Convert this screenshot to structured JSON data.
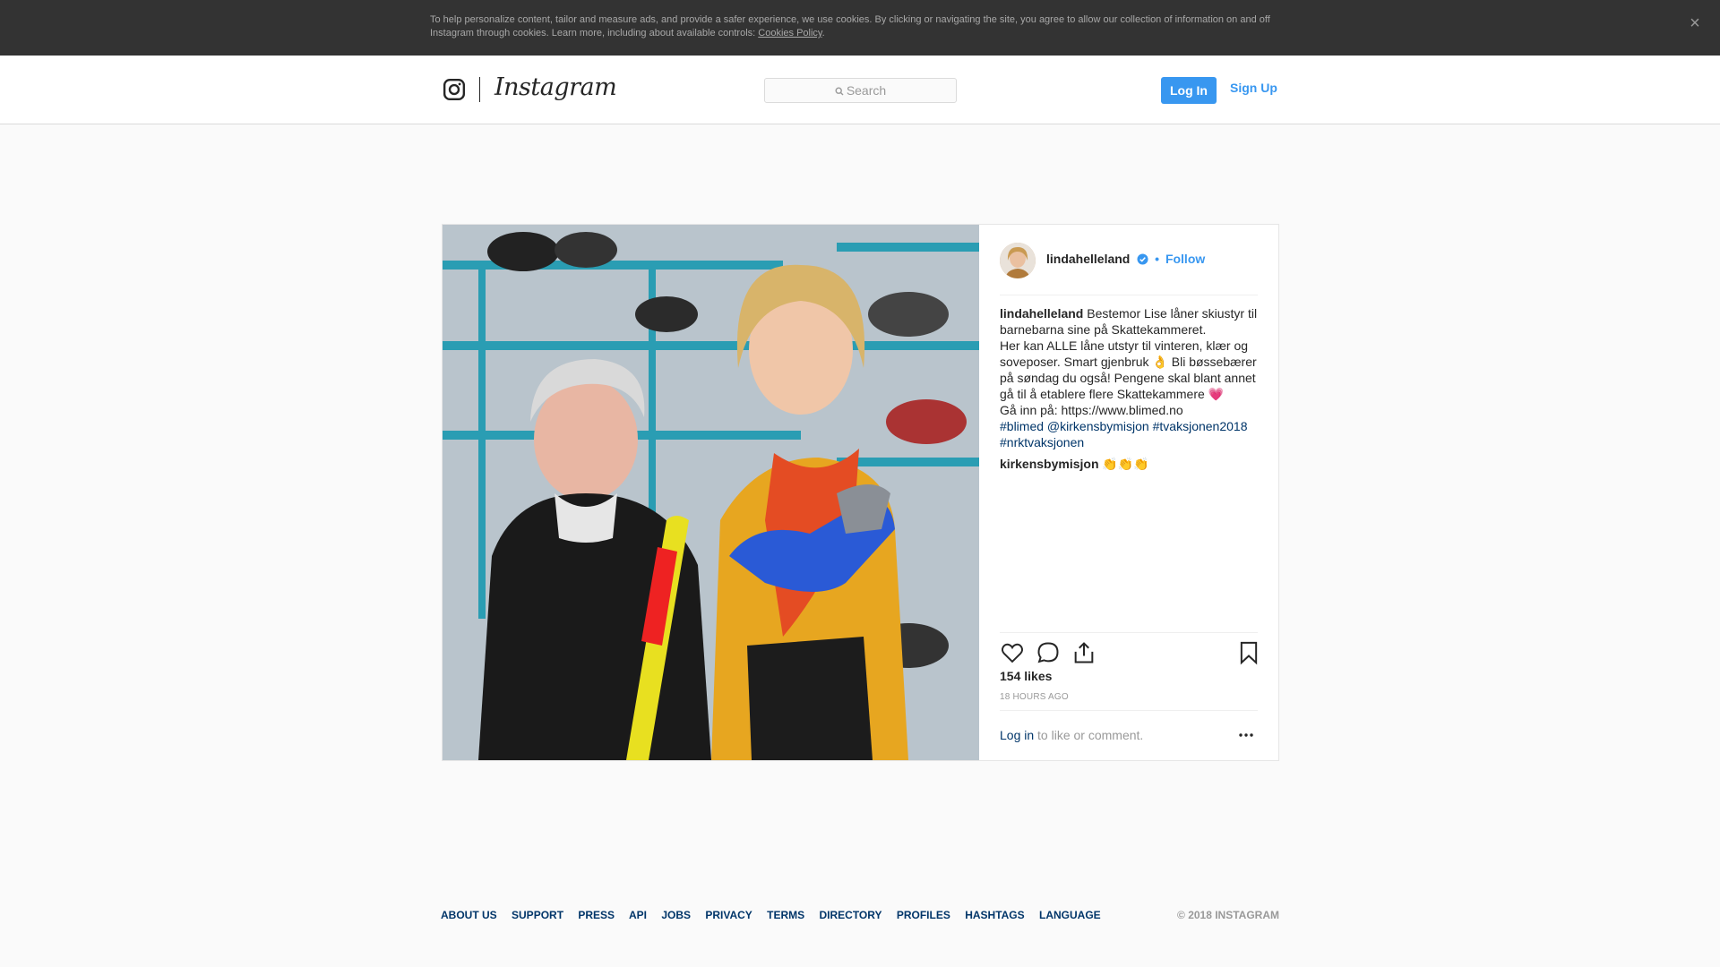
{
  "cookie_banner": {
    "text": "To help personalize content, tailor and measure ads, and provide a safer experience, we use cookies. By clicking or navigating the site, you agree to allow our collection of information on and off Instagram through cookies. Learn more, including about available controls: ",
    "link": "Cookies Policy",
    "suffix": ".",
    "close_icon": "close-icon"
  },
  "header": {
    "logo_text": "Instagram",
    "search_placeholder": "Search",
    "login_label": "Log In",
    "signup_label": "Sign Up"
  },
  "post": {
    "username": "lindahelleland",
    "dot": " • ",
    "follow_label": "Follow",
    "caption_user": "lindahelleland",
    "caption_lines": [
      "Bestemor Lise låner skiustyr til barnebarna sine på Skattekammeret.",
      "Her kan ALLE låne utstyr til vinteren, klær og soveposer. Smart gjenbruk 👌 Bli bøssebærer på søndag du også! Pengene skal blant annet gå til å etablere flere Skattekammere 💗",
      "Gå inn på: https://www.blimed.no"
    ],
    "hashtags": [
      "#blimed",
      "@kirkensbymisjon",
      "#tvaksjonen2018",
      "#nrktvaksjonen"
    ],
    "comment_user": "kirkensbymisjon",
    "comment_text": "👏👏👏",
    "likes": "154 likes",
    "time": "18 HOURS AGO",
    "login_link": "Log in",
    "login_suffix": " to like or comment."
  },
  "footer": {
    "links": [
      "ABOUT US",
      "SUPPORT",
      "PRESS",
      "API",
      "JOBS",
      "PRIVACY",
      "TERMS",
      "DIRECTORY",
      "PROFILES",
      "HASHTAGS",
      "LANGUAGE"
    ],
    "copyright": "© 2018 INSTAGRAM"
  },
  "colors": {
    "accent": "#3897f0",
    "link": "#003569",
    "banner": "#333333"
  }
}
